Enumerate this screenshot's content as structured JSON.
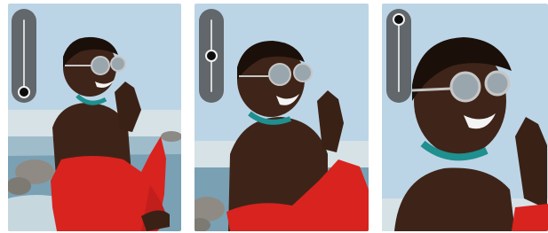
{
  "panels": [
    {
      "name": "zoom-level-1",
      "image": "woman-in-red-with-sunglasses-photo",
      "zoom_slider": {
        "value": 0.0
      }
    },
    {
      "name": "zoom-level-2",
      "image": "woman-in-red-with-sunglasses-photo",
      "zoom_slider": {
        "value": 0.5
      }
    },
    {
      "name": "zoom-level-3",
      "image": "woman-in-red-with-sunglasses-photo",
      "zoom_slider": {
        "value": 1.0
      }
    }
  ],
  "colors": {
    "sky": "#b9d3e4",
    "sea": "#6f98ae",
    "rocks": "#8c8a84",
    "dress": "#d8231f",
    "skin": "#4a2a1c",
    "necklace": "#1f8f8f",
    "slider_bg": "#484848",
    "slider_thumb": "#0d0d0d"
  }
}
